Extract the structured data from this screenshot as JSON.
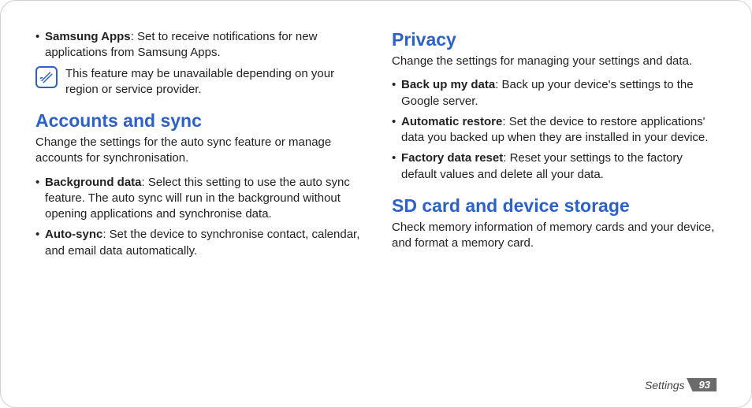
{
  "left": {
    "samsung_apps_label": "Samsung Apps",
    "samsung_apps_text": ": Set to receive notifications for new applications from Samsung Apps.",
    "note_text": "This feature may be unavailable depending on your region or service provider.",
    "accounts_heading": "Accounts and sync",
    "accounts_intro": "Change the settings for the auto sync feature or manage accounts for synchronisation.",
    "bg_data_label": "Background data",
    "bg_data_text": ": Select this setting to use the auto sync feature. The auto sync will run in the background without opening applications and synchronise data.",
    "autosync_label": "Auto-sync",
    "autosync_text": ": Set the device to synchronise contact, calendar, and email data automatically."
  },
  "right": {
    "privacy_heading": "Privacy",
    "privacy_intro": "Change the settings for managing your settings and data.",
    "backup_label": "Back up my data",
    "backup_text": ": Back up your device's settings to the Google server.",
    "restore_label": "Automatic restore",
    "restore_text": ": Set the device to restore applications' data you backed up when they are installed in your device.",
    "factory_label": "Factory data reset",
    "factory_text": ": Reset your settings to the factory default values and delete all your data.",
    "sd_heading": "SD card and device storage",
    "sd_intro": "Check memory information of memory cards and your device, and format a memory card."
  },
  "footer": {
    "section": "Settings",
    "page": "93"
  }
}
